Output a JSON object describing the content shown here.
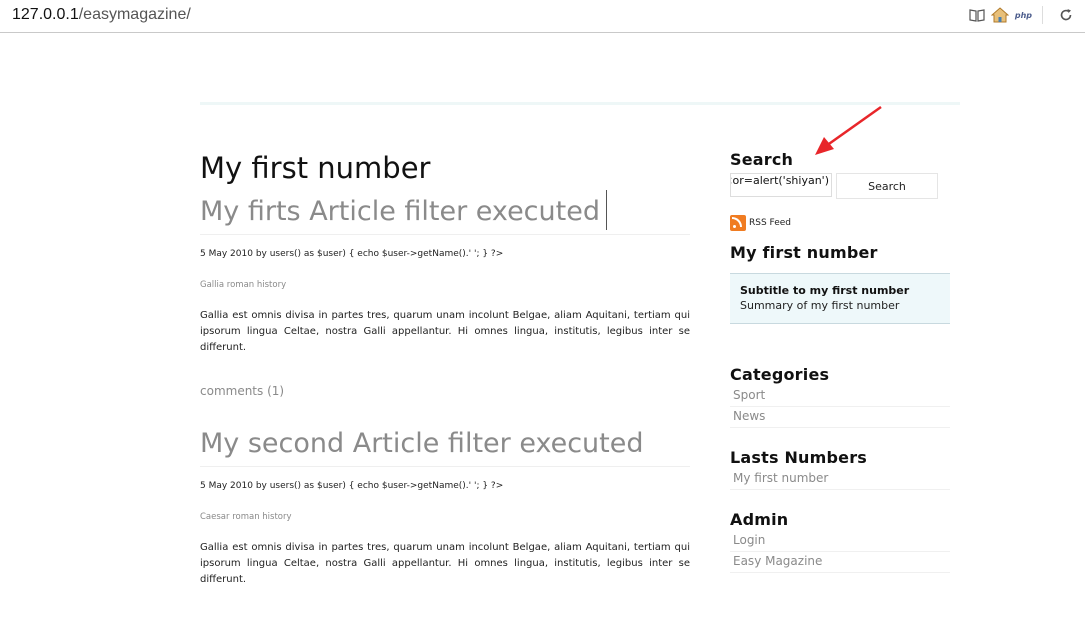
{
  "browser": {
    "url_host": "127.0.0.1",
    "url_path": "/easymagazine/",
    "icons": [
      "reader-icon",
      "home-icon",
      "php-icon",
      "reload-icon"
    ],
    "php_label": "php"
  },
  "main": {
    "title": "My first number",
    "articles": [
      {
        "title": "My firts Article filter executed",
        "meta": "5 May 2010 by users() as $user) { echo $user->getName().' '; } ?>",
        "category": "Gallia roman history",
        "body": "Gallia est omnis divisa in partes tres, quarum unam incolunt Belgae, aliam Aquitani, tertiam qui ipsorum lingua Celtae, nostra Galli appellantur. Hi omnes lingua, institutis, legibus inter se differunt.",
        "comments": "comments  (1)"
      },
      {
        "title": "My second Article filter executed",
        "meta": "5 May 2010 by users() as $user) { echo $user->getName().' '; } ?>",
        "category": "Caesar roman history",
        "body": "Gallia est omnis divisa in partes tres, quarum unam incolunt Belgae, aliam Aquitani, tertiam qui ipsorum lingua Celtae, nostra Galli appellantur. Hi omnes lingua, institutis, legibus inter se differunt."
      }
    ]
  },
  "sidebar": {
    "search_heading": "Search",
    "search_value": "or=alert('shiyan')>",
    "search_button": "Search",
    "rss_label": "RSS Feed",
    "number_heading": "My first number",
    "number_subtitle": "Subtitle to my first number",
    "number_summary": "Summary of my first number",
    "categories_heading": "Categories",
    "categories": [
      "Sport",
      "News"
    ],
    "lasts_heading": "Lasts Numbers",
    "lasts": [
      "My first number"
    ],
    "admin_heading": "Admin",
    "admin": [
      "Login",
      "Easy Magazine"
    ]
  },
  "colors": {
    "arrow": "#e8262a",
    "accent_box": "#eef8fa",
    "muted_text": "#8a8a8a"
  }
}
